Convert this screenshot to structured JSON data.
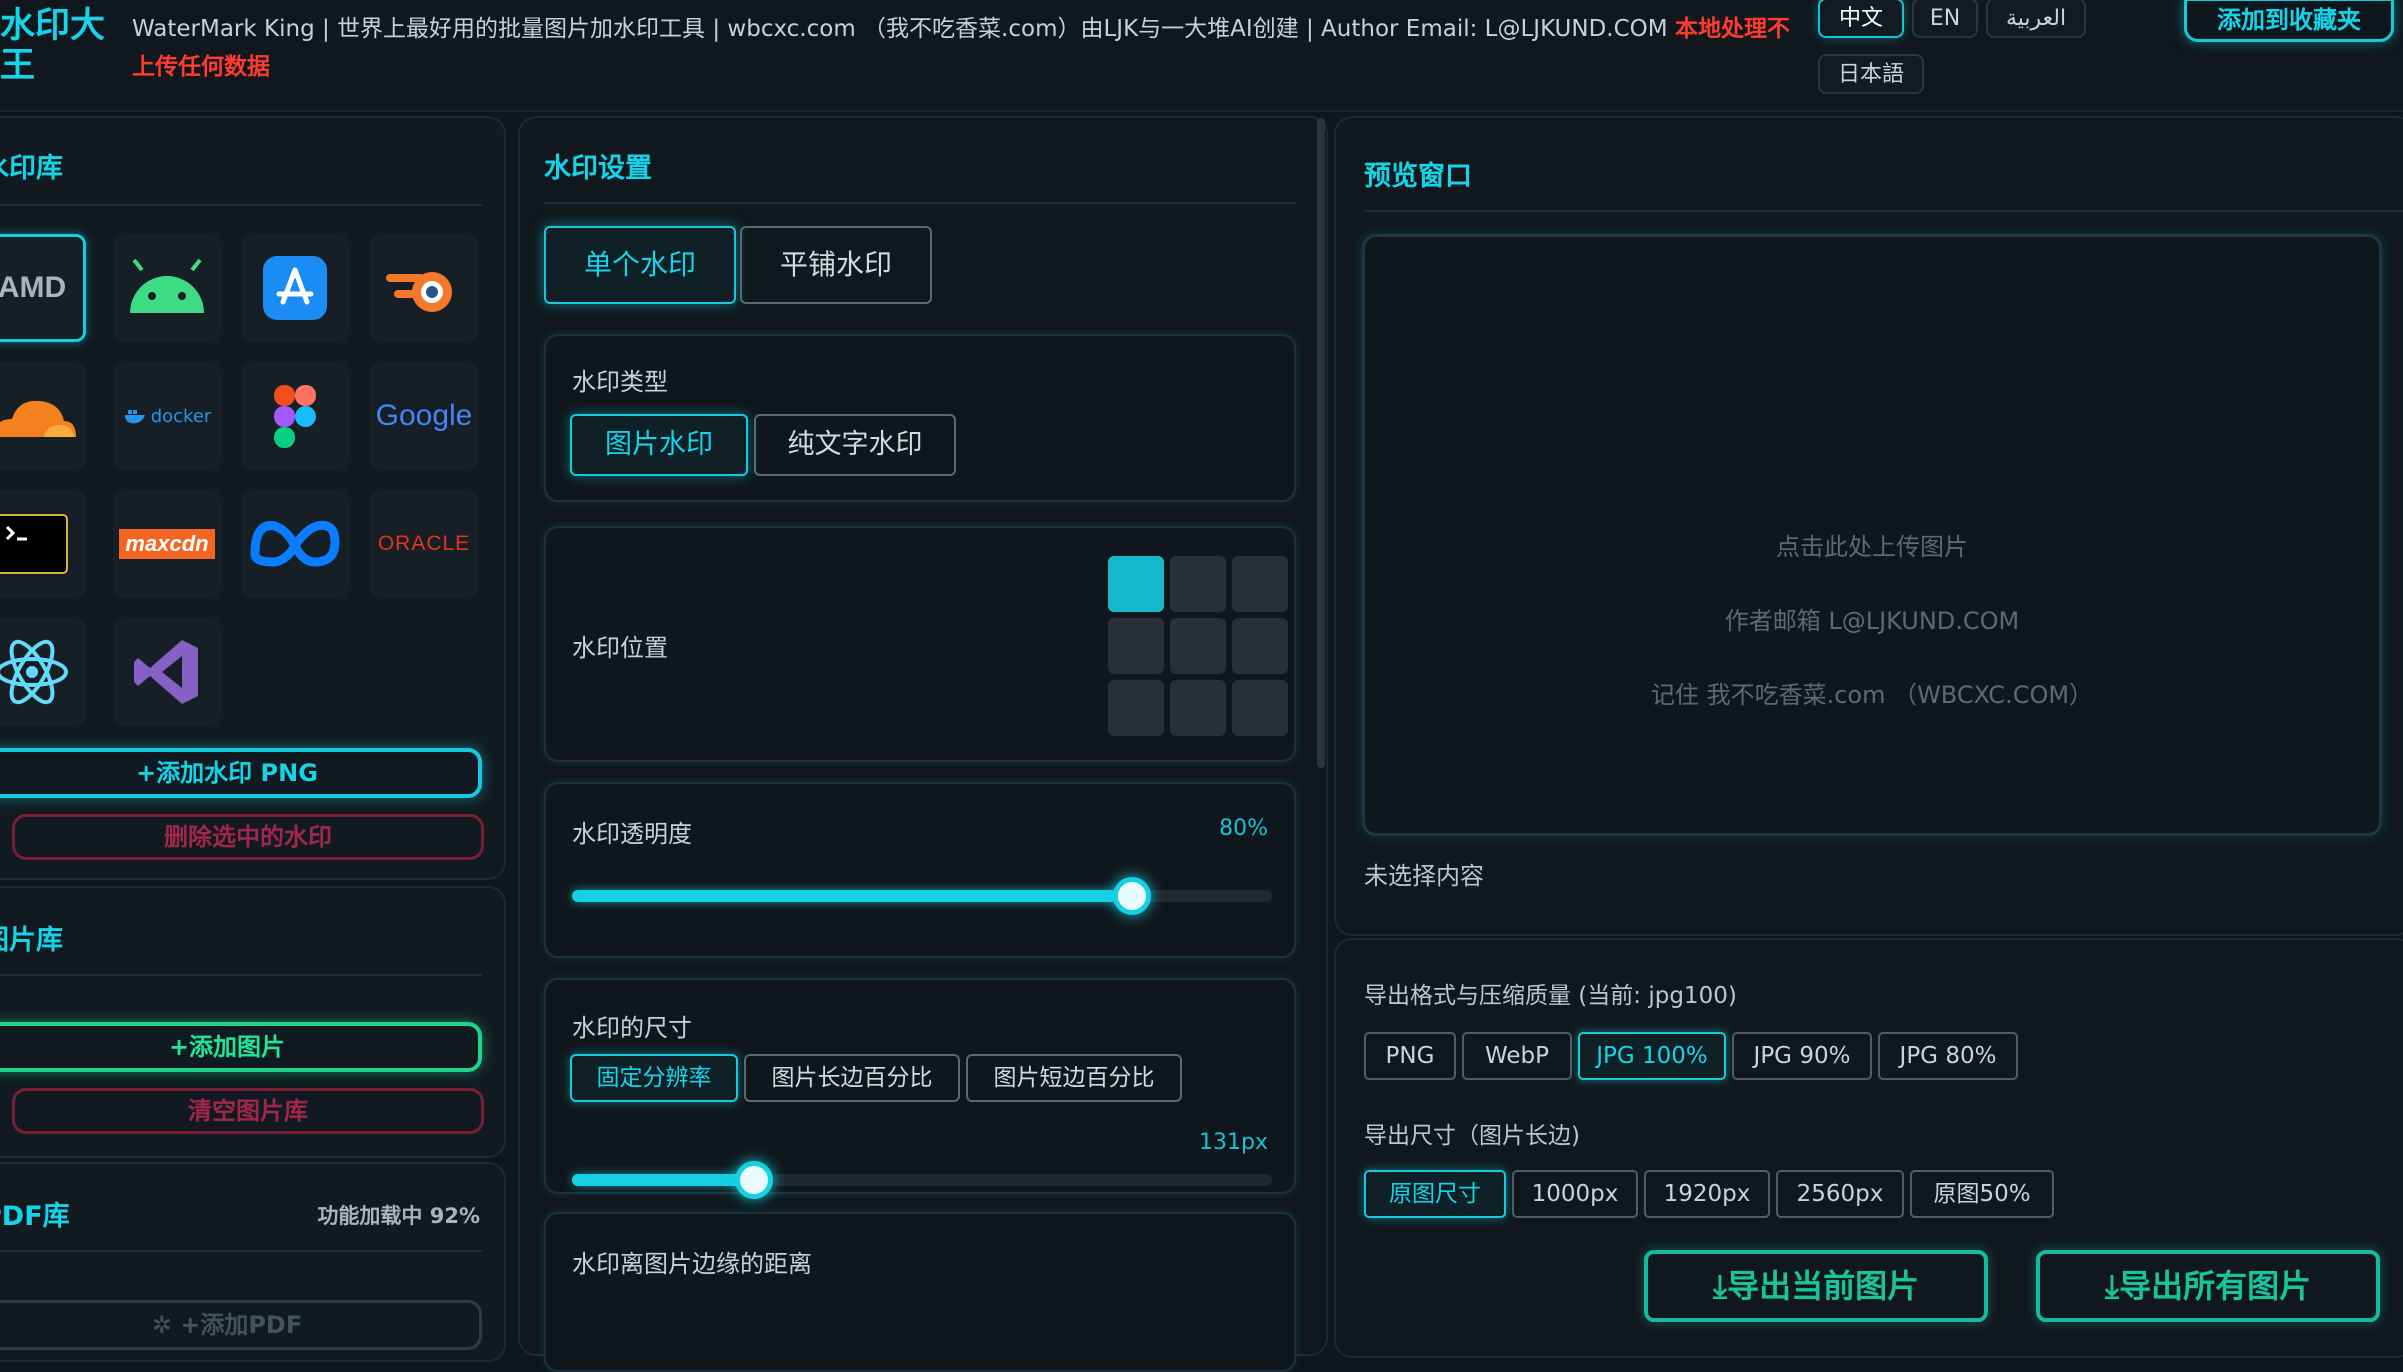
{
  "header": {
    "logo": "水印大王",
    "intro": "WaterMark King | 世界上最好用的批量图片加水印工具 | wbcxc.com （我不吃香菜.com）由LJK与一大堆AI创建 | Author Email: L@LJKUND.COM ",
    "privacy": "本地处理不上传任何数据",
    "languages": [
      "中文",
      "EN",
      "العربية",
      "日本語"
    ],
    "favorite": "添加到收藏夹"
  },
  "watermark_library": {
    "title": "水印库",
    "icons": [
      "amd-logo-icon",
      "android-icon",
      "app-store-icon",
      "blender-icon",
      "cloudflare-icon",
      "docker-icon",
      "figma-icon",
      "google-icon",
      "terminal-icon",
      "maxcdn-icon",
      "meta-icon",
      "oracle-icon",
      "react-icon",
      "visual-studio-icon"
    ],
    "icon_text": {
      "amd": "AMD",
      "docker": "docker",
      "google": "Google",
      "maxcdn": "maxcdn",
      "oracle": "ORACLE"
    },
    "add_button": "+添加水印 PNG",
    "delete_button": "删除选中的水印"
  },
  "image_library": {
    "title": "图片库",
    "add_button": "+添加图片",
    "clear_button": "清空图片库"
  },
  "pdf_library": {
    "title": "PDF库",
    "status": "功能加载中 92%",
    "add_button": "✲ +添加PDF"
  },
  "settings": {
    "title": "水印设置",
    "mode_tabs": [
      "单个水印",
      "平铺水印"
    ],
    "type_label": "水印类型",
    "type_options": [
      "图片水印",
      "纯文字水印"
    ],
    "position_label": "水印位置",
    "position_selected": 0,
    "opacity_label": "水印透明度",
    "opacity_value": "80%",
    "opacity_fraction": 0.8,
    "size_label": "水印的尺寸",
    "size_options": [
      "固定分辨率",
      "图片长边百分比",
      "图片短边百分比"
    ],
    "size_value": "131px",
    "size_fraction": 0.26,
    "margin_label": "水印离图片边缘的距离"
  },
  "preview": {
    "title": "预览窗口",
    "lines": [
      "点击此处上传图片",
      "作者邮箱 L@LJKUND.COM",
      "记住 我不吃香菜.com （WBCXC.COM）"
    ],
    "status": "未选择内容"
  },
  "export": {
    "format_label": "导出格式与压缩质量 (当前: jpg100)",
    "formats": [
      "PNG",
      "WebP",
      "JPG 100%",
      "JPG 90%",
      "JPG 80%"
    ],
    "size_label": "导出尺寸（图片长边)",
    "sizes": [
      "原图尺寸",
      "1000px",
      "1920px",
      "2560px",
      "原图50%"
    ],
    "export_current": "导出当前图片",
    "export_all": "导出所有图片"
  },
  "colors": {
    "accent": "#16d4e8",
    "green": "#1fd38b",
    "red": "#a3264a",
    "background": "#0f161c"
  }
}
